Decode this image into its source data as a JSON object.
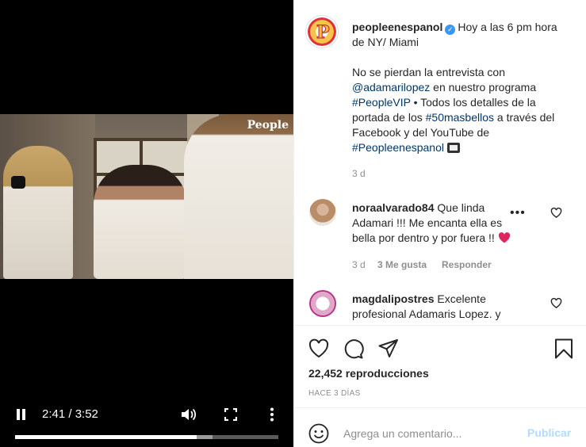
{
  "video": {
    "brand_overlay": "People",
    "time": "2:41 / 3:52",
    "progress_fraction": 0.69,
    "buffered_fraction": 0.75,
    "icons": {
      "pause": "pause-icon",
      "volume": "volume-icon",
      "fullscreen": "fullscreen-icon",
      "more": "more-vertical-icon"
    }
  },
  "post": {
    "username": "peopleenespanol",
    "caption_line1": "Hoy a las 6 pm hora de NY/ Miami",
    "caption_p2_a": "No se pierdan la entrevista con ",
    "mention": "@adamarilopez",
    "caption_p2_b": " en nuestro programa ",
    "hashtag1": "#PeopleVIP",
    "caption_p2_c": " • Todos los detalles de la portada de los ",
    "hashtag2": "#50masbellos",
    "caption_p2_d": " a través del Facebook y del YouTube de ",
    "hashtag3": "#Peopleenespanol",
    "time_ago": "3 d"
  },
  "comments": [
    {
      "username": "noraalvarado84",
      "text": "Que linda Adamari !!! Me encanta ella es bella por dentro y por fuera !!",
      "time_ago": "3 d",
      "likes": "3 Me gusta",
      "reply": "Responder",
      "more": "•••"
    },
    {
      "username": "magdalipostres",
      "text": "Excelente profesional Adamaris Lopez. y"
    }
  ],
  "actions": {
    "views_count": "22,452",
    "views_label": "reproducciones",
    "date": "HACE 3 DÍAS"
  },
  "comment_box": {
    "placeholder": "Agrega un comentario...",
    "publish": "Publicar"
  },
  "colors": {
    "link": "#00376b",
    "verified": "#3897f0",
    "heart": "#ed4956",
    "publish_disabled": "#b3dbff",
    "muted": "#8e8e8e"
  }
}
